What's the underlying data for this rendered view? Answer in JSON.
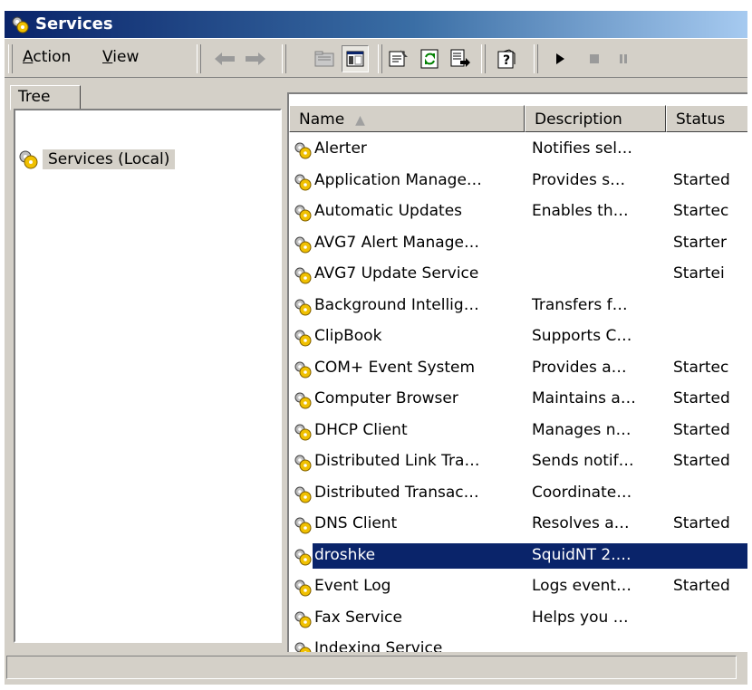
{
  "window": {
    "title": "Services"
  },
  "toolbar": {
    "menu": [
      {
        "label": "Action",
        "mnemonic": "A",
        "rest": "ction"
      },
      {
        "label": "View",
        "mnemonic": "V",
        "rest": "iew"
      }
    ],
    "buttons": [
      "back-icon",
      "forward-icon",
      "up-folder-icon",
      "show-hide-tree-icon",
      "properties-icon",
      "refresh-icon",
      "export-list-icon",
      "help-icon",
      "start-icon",
      "stop-icon",
      "pause-icon"
    ]
  },
  "tree": {
    "tab_label": "Tree",
    "root": "Services (Local)"
  },
  "list": {
    "columns": [
      "Name",
      "Description",
      "Status"
    ],
    "sort_indicator": "▲",
    "rows": [
      {
        "name": "Alerter",
        "description": "Notifies sel…",
        "status": ""
      },
      {
        "name": "Application Manage…",
        "description": "Provides s…",
        "status": "Started"
      },
      {
        "name": "Automatic Updates",
        "description": "Enables th…",
        "status": "Startec"
      },
      {
        "name": "AVG7 Alert Manage…",
        "description": "",
        "status": "Starter"
      },
      {
        "name": "AVG7 Update Service",
        "description": "",
        "status": "Startei"
      },
      {
        "name": "Background Intellig…",
        "description": "Transfers f…",
        "status": ""
      },
      {
        "name": "ClipBook",
        "description": "Supports C…",
        "status": ""
      },
      {
        "name": "COM+ Event System",
        "description": "Provides a…",
        "status": "Startec"
      },
      {
        "name": "Computer Browser",
        "description": "Maintains a…",
        "status": "Started"
      },
      {
        "name": "DHCP Client",
        "description": "Manages n…",
        "status": "Started"
      },
      {
        "name": "Distributed Link Tra…",
        "description": "Sends notif…",
        "status": "Started"
      },
      {
        "name": "Distributed Transac…",
        "description": "Coordinate…",
        "status": ""
      },
      {
        "name": "DNS Client",
        "description": "Resolves a…",
        "status": "Started"
      },
      {
        "name": "droshke",
        "description": "SquidNT 2.…",
        "status": "",
        "selected": true
      },
      {
        "name": "Event Log",
        "description": "Logs event…",
        "status": "Started"
      },
      {
        "name": "Fax Service",
        "description": "Helps you …",
        "status": ""
      },
      {
        "name": "Indexing Service",
        "description": "",
        "status": ""
      }
    ]
  },
  "colors": {
    "titlebar_start": "#0a246a",
    "titlebar_end": "#a6caf0",
    "selection": "#0a246a",
    "face": "#d4d0c8"
  }
}
